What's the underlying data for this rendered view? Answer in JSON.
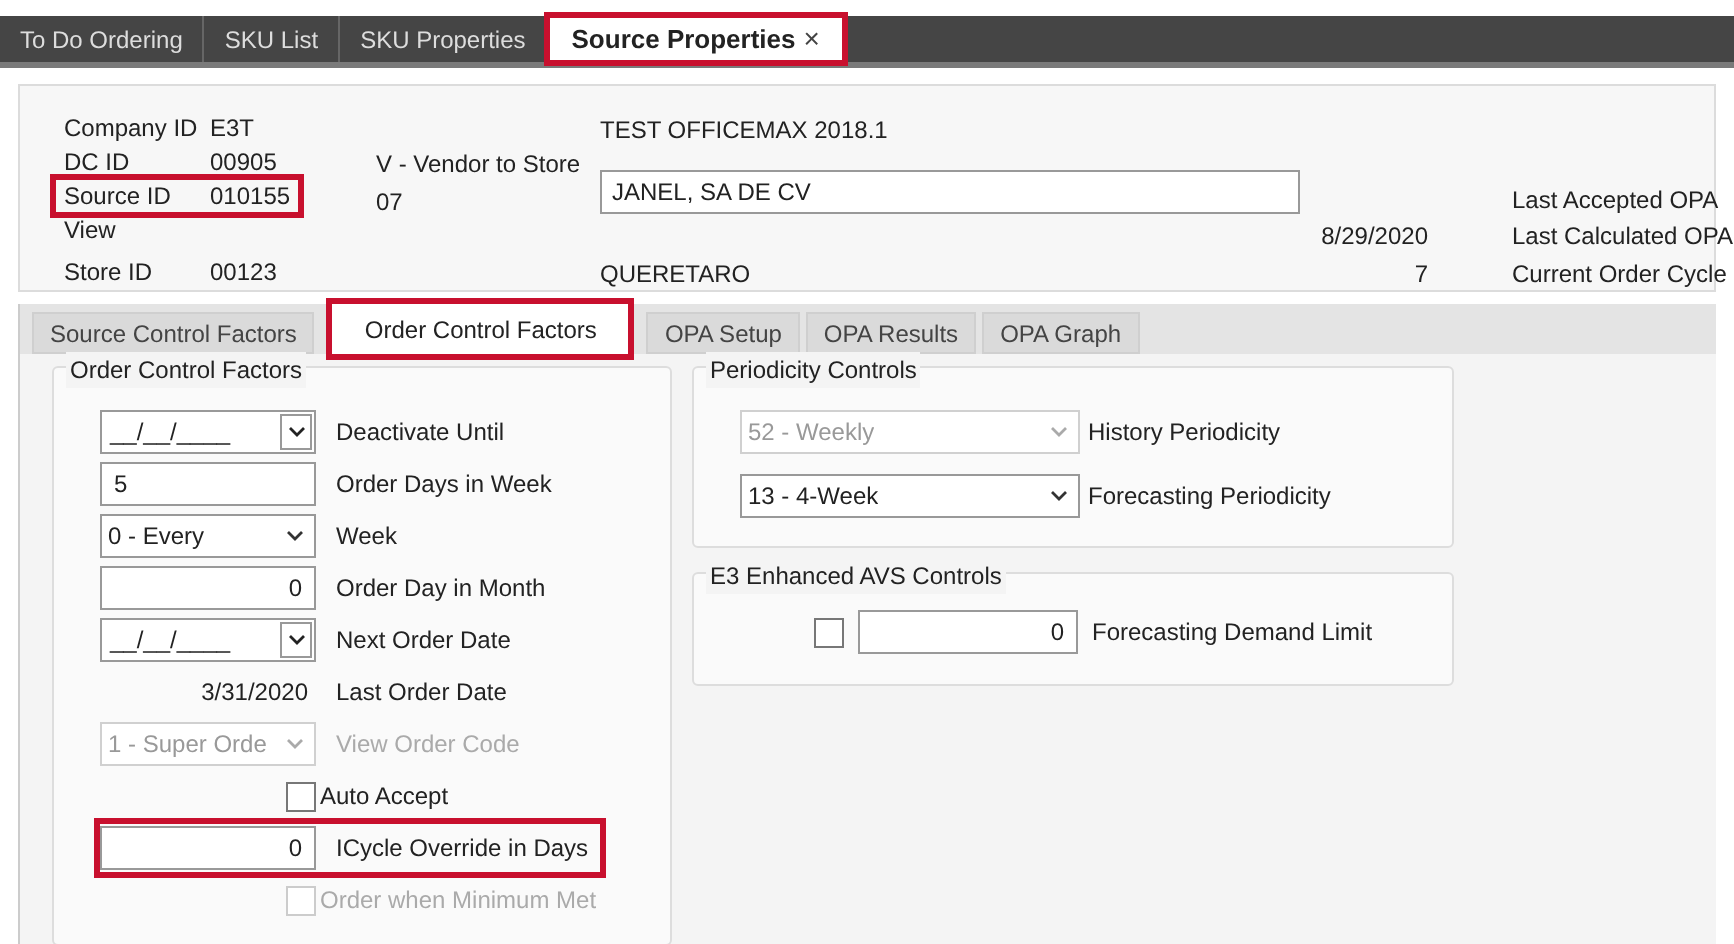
{
  "top_tabs": [
    {
      "label": "To Do Ordering",
      "selected": false,
      "closable": false,
      "highlighted": false
    },
    {
      "label": "SKU List",
      "selected": false,
      "closable": false,
      "highlighted": false
    },
    {
      "label": "SKU Properties",
      "selected": false,
      "closable": false,
      "highlighted": false
    },
    {
      "label": "Source Properties",
      "selected": true,
      "closable": true,
      "highlighted": true
    }
  ],
  "close_glyph": "×",
  "header": {
    "ids": [
      {
        "label": "Company ID",
        "value": "E3T",
        "highlighted": false
      },
      {
        "label": "DC ID",
        "value": "00905",
        "highlighted": false
      },
      {
        "label": "Source ID",
        "value": "010155",
        "highlighted": true
      },
      {
        "label": "View",
        "highlighted": false
      },
      {
        "label": "Store ID",
        "value": "00123",
        "highlighted": false
      }
    ],
    "source_type": "V - Vendor to Store",
    "source_code": "07",
    "company_name": "TEST OFFICEMAX  2018.1",
    "vendor_name": "JANEL, SA DE CV",
    "city": "QUERETARO",
    "opa": [
      {
        "label": "Last Accepted OPA"
      },
      {
        "value": "8/29/2020",
        "label": "Last Calculated OPA"
      },
      {
        "value": "7",
        "label": "Current Order Cycle"
      }
    ]
  },
  "sub_tabs": [
    {
      "label": "Source Control Factors",
      "selected": false,
      "highlighted": false
    },
    {
      "label": "Order Control Factors",
      "selected": true,
      "highlighted": true
    },
    {
      "label": "OPA Setup",
      "selected": false,
      "highlighted": false
    },
    {
      "label": "OPA Results",
      "selected": false,
      "highlighted": false
    },
    {
      "label": "OPA Graph",
      "selected": false,
      "highlighted": false
    }
  ],
  "order_control": {
    "title": "Order Control Factors",
    "rows": [
      {
        "kind": "date",
        "value": "__/__/____",
        "label": "Deactivate Until",
        "disabled": false,
        "highlighted": false
      },
      {
        "kind": "text",
        "value": "5",
        "label": "Order Days in Week",
        "disabled": false,
        "highlighted": false
      },
      {
        "kind": "select",
        "value": "0 - Every",
        "label": "Week",
        "disabled": false,
        "highlighted": false
      },
      {
        "kind": "number",
        "value": "0",
        "label": "Order Day in Month",
        "disabled": false,
        "highlighted": false
      },
      {
        "kind": "date",
        "value": "__/__/____",
        "label": "Next Order Date",
        "disabled": false,
        "highlighted": false
      },
      {
        "kind": "readonly",
        "value": "3/31/2020",
        "label": "Last Order Date",
        "disabled": false,
        "highlighted": false
      },
      {
        "kind": "select",
        "value": "1 - Super Orde",
        "label": "View Order Code",
        "disabled": true,
        "highlighted": false
      },
      {
        "kind": "checkbox",
        "checked": false,
        "label": "Auto Accept",
        "disabled": false,
        "highlighted": false
      },
      {
        "kind": "number",
        "value": "0",
        "label": "ICycle Override in Days",
        "disabled": false,
        "highlighted": true
      },
      {
        "kind": "checkbox",
        "checked": false,
        "label": "Order when Minimum Met",
        "disabled": true,
        "highlighted": false
      }
    ]
  },
  "periodicity": {
    "title": "Periodicity Controls",
    "rows": [
      {
        "value": "52 - Weekly",
        "label": "History Periodicity",
        "disabled": true
      },
      {
        "value": "13 - 4-Week",
        "label": "Forecasting Periodicity",
        "disabled": false
      }
    ]
  },
  "avs": {
    "title": "E3 Enhanced AVS Controls",
    "checked": false,
    "value": "0",
    "label": "Forecasting Demand Limit"
  }
}
